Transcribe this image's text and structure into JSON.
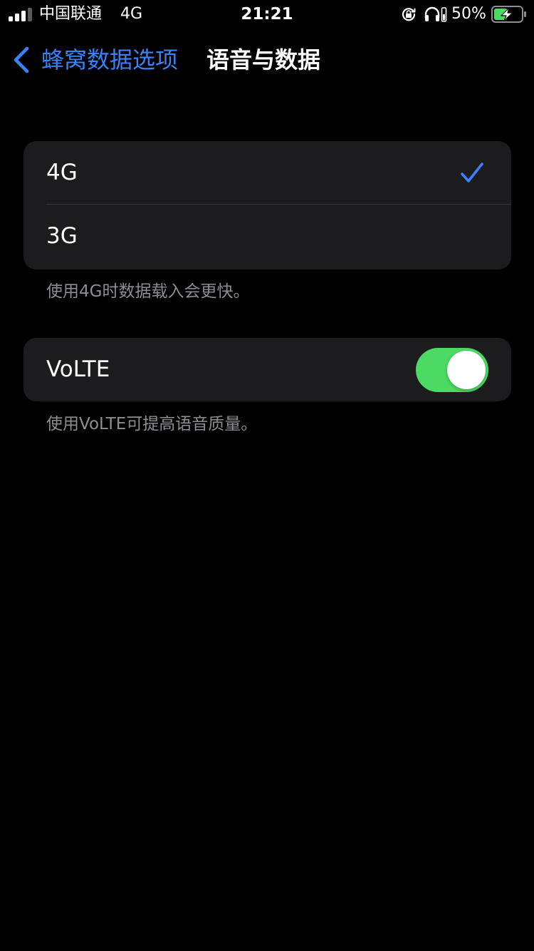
{
  "colors": {
    "background": "#000000",
    "group_bg": "#1c1c1e",
    "accent_blue": "#3a82f7",
    "toggle_on_green": "#4cd964",
    "footnote_gray": "#8d8d93",
    "battery_green": "#4cd964"
  },
  "status_bar": {
    "signal_bars_active": 3,
    "signal_bars_total": 4,
    "carrier": "中国联通",
    "network_type": "4G",
    "time": "21:21",
    "icons": [
      "orientation-lock-icon",
      "headphones-icon",
      "battery-charging-icon"
    ],
    "battery_percent": "50%",
    "battery_level": 0.5
  },
  "nav": {
    "back_label": "蜂窝数据选项",
    "title": "语音与数据"
  },
  "network_options": {
    "items": [
      {
        "label": "4G",
        "selected": true
      },
      {
        "label": "3G",
        "selected": false
      }
    ],
    "footer": "使用4G时数据载入会更快。"
  },
  "volte": {
    "label": "VoLTE",
    "enabled": true,
    "footer": "使用VoLTE可提高语音质量。"
  }
}
